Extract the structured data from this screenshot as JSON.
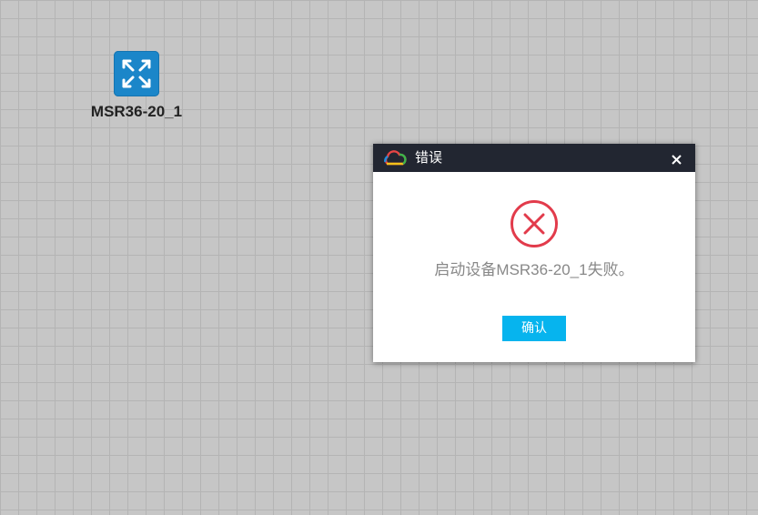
{
  "canvas": {
    "device": {
      "icon": "router-switch-icon",
      "label": "MSR36-20_1"
    }
  },
  "dialog": {
    "title": "错误",
    "logo_icon": "cloud-logo-icon",
    "close_icon": "close-icon",
    "status_icon": "error-circle-icon",
    "message": "启动设备MSR36-20_1失败。",
    "ok_label": "确认"
  },
  "colors": {
    "titlebar": "#222631",
    "ok_button": "#06b4ee",
    "error": "#e23b4b",
    "device_icon": "#1b86c9"
  }
}
